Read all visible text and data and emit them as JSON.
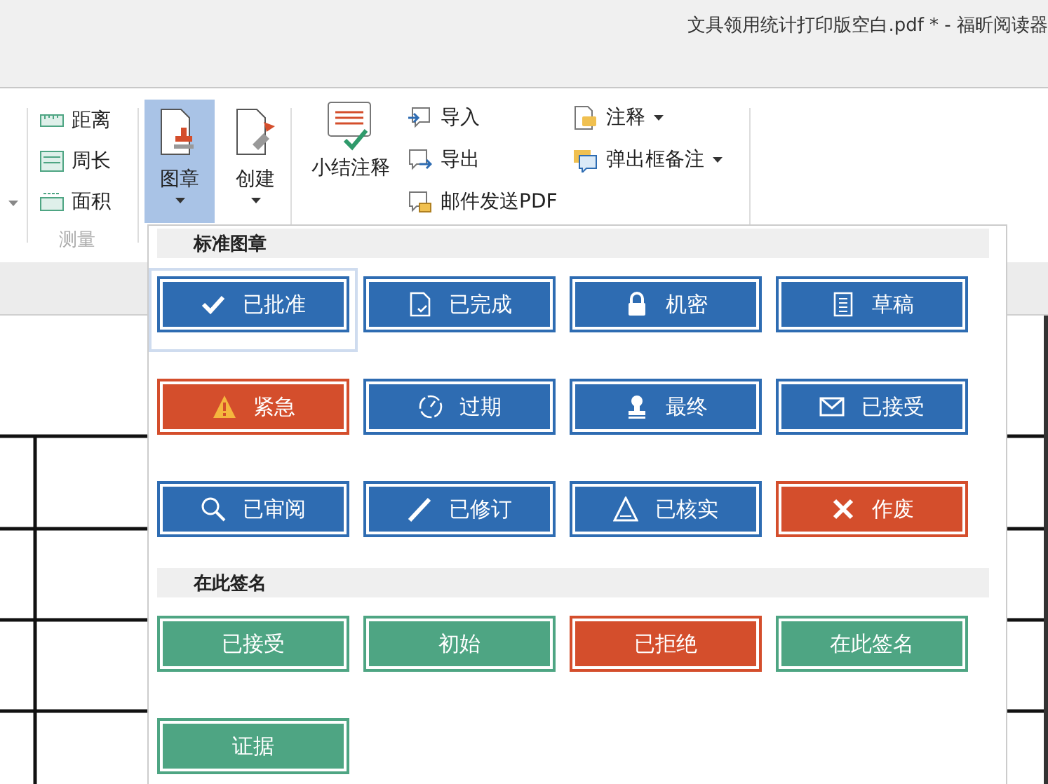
{
  "window": {
    "title": "文具领用统计打印版空白.pdf * - 福昕阅读器"
  },
  "ribbon": {
    "measure": {
      "items": [
        "距离",
        "周长",
        "面积"
      ],
      "label": "测量"
    },
    "big_buttons": [
      {
        "label": "图章",
        "selected": true
      },
      {
        "label": "创建",
        "selected": false
      }
    ],
    "summary_button": {
      "label": "小结注释"
    },
    "data_items": [
      "导入",
      "导出",
      "邮件发送PDF"
    ],
    "comment_items": [
      "注释",
      "弹出框备注"
    ]
  },
  "stamp_menu": {
    "sections": [
      {
        "title": "标准图章",
        "stamps": [
          {
            "label": "已批准",
            "color": "#2e6cb2",
            "selected": true
          },
          {
            "label": "已完成",
            "color": "#2e6cb2",
            "selected": false
          },
          {
            "label": "机密",
            "color": "#2e6cb2",
            "selected": false
          },
          {
            "label": "草稿",
            "color": "#2e6cb2",
            "selected": false
          },
          {
            "label": "紧急",
            "color": "#d44e2c",
            "selected": false
          },
          {
            "label": "过期",
            "color": "#2e6cb2",
            "selected": false
          },
          {
            "label": "最终",
            "color": "#2e6cb2",
            "selected": false
          },
          {
            "label": "已接受",
            "color": "#2e6cb2",
            "selected": false
          },
          {
            "label": "已审阅",
            "color": "#2e6cb2",
            "selected": false
          },
          {
            "label": "已修订",
            "color": "#2e6cb2",
            "selected": false
          },
          {
            "label": "已核实",
            "color": "#2e6cb2",
            "selected": false
          },
          {
            "label": "作废",
            "color": "#d44e2c",
            "selected": false
          }
        ]
      },
      {
        "title": "在此签名",
        "stamps": [
          {
            "label": "已接受",
            "color": "#4ea583",
            "selected": false
          },
          {
            "label": "初始",
            "color": "#4ea583",
            "selected": false
          },
          {
            "label": "已拒绝",
            "color": "#d44e2c",
            "selected": false
          },
          {
            "label": "在此签名",
            "color": "#4ea583",
            "selected": false
          },
          {
            "label": "证据",
            "color": "#4ea583",
            "selected": false
          }
        ]
      }
    ]
  }
}
